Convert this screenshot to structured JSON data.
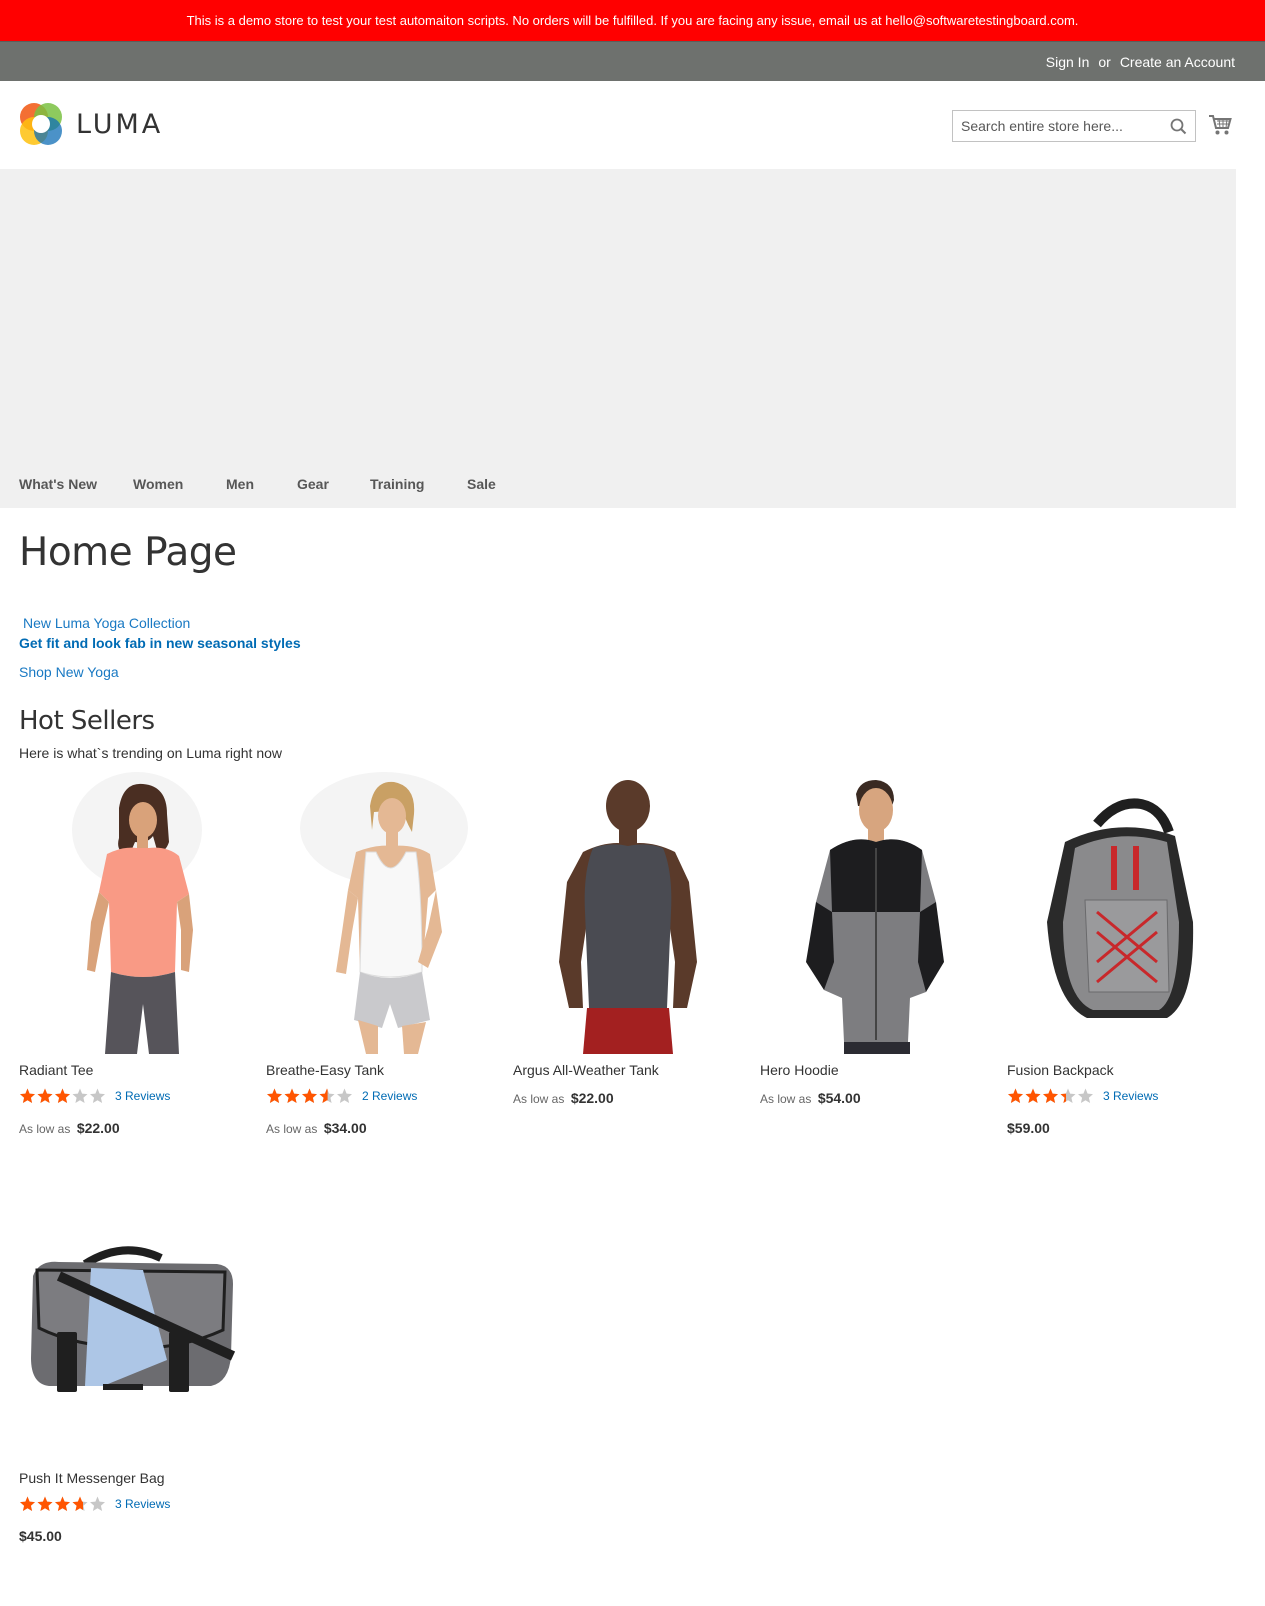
{
  "banner": {
    "text": "This is a demo store to test your test automaiton scripts. No orders will be fulfilled. If you are facing any issue, email us at hello@softwaretestingboard.com."
  },
  "top_links": {
    "sign_in": "Sign In",
    "or": "or",
    "create_account": "Create an Account"
  },
  "logo": {
    "text": "LUMA"
  },
  "search": {
    "placeholder": "Search entire store here..."
  },
  "nav": [
    "What's New",
    "Women",
    "Men",
    "Gear",
    "Training",
    "Sale"
  ],
  "page": {
    "title": "Home Page",
    "promo_title": "New Luma Yoga Collection",
    "promo_subtitle": "Get fit and look fab in new seasonal styles",
    "promo_link": "Shop New Yoga"
  },
  "hot_sellers": {
    "title": "Hot Sellers",
    "subtitle": "Here is what`s trending on Luma right now",
    "products": [
      {
        "name": "Radiant Tee",
        "rating_percent": 60,
        "reviews": "3 Reviews",
        "price_label": "As low as",
        "price": "$22.00"
      },
      {
        "name": "Breathe-Easy Tank",
        "rating_percent": 70,
        "reviews": "2 Reviews",
        "price_label": "As low as",
        "price": "$34.00"
      },
      {
        "name": "Argus All-Weather Tank",
        "rating_percent": null,
        "reviews": "",
        "price_label": "As low as",
        "price": "$22.00"
      },
      {
        "name": "Hero Hoodie",
        "rating_percent": null,
        "reviews": "",
        "price_label": "As low as",
        "price": "$54.00"
      },
      {
        "name": "Fusion Backpack",
        "rating_percent": 67,
        "reviews": "3 Reviews",
        "price_label": "",
        "price": "$59.00"
      },
      {
        "name": "Push It Messenger Bag",
        "rating_percent": 73,
        "reviews": "3 Reviews",
        "price_label": "",
        "price": "$45.00"
      }
    ]
  },
  "colors": {
    "banner": "#ff0000",
    "top_bar": "#6e716e",
    "link": "#1979c3",
    "star": "#ff5501"
  }
}
